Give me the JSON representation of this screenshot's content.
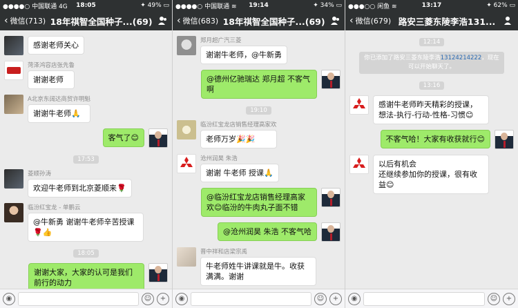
{
  "screens": [
    {
      "status": {
        "carrier": "●●●●○ 中国联通 4G",
        "time": "18:05",
        "right": "✦ 49% ▭"
      },
      "nav": {
        "back": "微信(713)",
        "title": "18年祺智全国种子...(69)"
      },
      "items": [
        {
          "kind": "msg",
          "side": "left",
          "avatar": "av-dark",
          "sender": "",
          "text": "感谢老师关心"
        },
        {
          "kind": "msg",
          "side": "left",
          "avatar": "av-logo",
          "sender": "菏泽鸿容店张先鲁",
          "text": "谢谢老师"
        },
        {
          "kind": "msg",
          "side": "left",
          "avatar": "av-photo",
          "sender": "A北京东阔达商贸许明魁",
          "text": "谢谢牛老师🙏"
        },
        {
          "kind": "msg",
          "side": "right",
          "avatar": "av-user",
          "sender": "",
          "text": "客气了😊"
        },
        {
          "kind": "ts",
          "text": "17:53"
        },
        {
          "kind": "msg",
          "side": "left",
          "avatar": "av-dark",
          "sender": "菱顺孙涛",
          "text": "欢迎牛老师到北京菱顺来🌹"
        },
        {
          "kind": "msg",
          "side": "left",
          "avatar": "av-person",
          "sender": "临汾红宝龙 - 单鹏云",
          "text": "@牛新勇 谢谢牛老师辛苦授课🌹👍"
        },
        {
          "kind": "ts",
          "text": "18:05"
        },
        {
          "kind": "msg",
          "side": "right",
          "avatar": "av-user",
          "sender": "",
          "text": "谢谢大家，大家的认可是我们前行的动力"
        }
      ]
    },
    {
      "status": {
        "carrier": "●●●●○ 中国联通 ≋",
        "time": "19:14",
        "right": "✦ 34% ▭"
      },
      "nav": {
        "back": "微信(683)",
        "title": "18年祺智全国种子...(69)"
      },
      "items": [
        {
          "kind": "msg",
          "side": "left",
          "avatar": "av-cat",
          "sender": "郑月超广汽三菱",
          "text": "谢谢牛老师，@牛新勇"
        },
        {
          "kind": "msg",
          "side": "right",
          "avatar": "av-user",
          "sender": "",
          "text": "@德州亿驰瑞达 郑月超 不客气啊"
        },
        {
          "kind": "ts",
          "text": "19:10"
        },
        {
          "kind": "msg",
          "side": "left",
          "avatar": "av-flower",
          "sender": "临汾红宝龙店销售经理高家欢",
          "text": "老师万岁🎉🎉"
        },
        {
          "kind": "msg",
          "side": "left",
          "avatar": "av-red",
          "sender": "沧州润昊 朱浩",
          "text": "谢谢 牛老师 授课🙏"
        },
        {
          "kind": "msg",
          "side": "right",
          "avatar": "av-user",
          "sender": "",
          "text": "@临汾红宝龙店销售经理高家欢😊临汾的牛肉丸子面不错"
        },
        {
          "kind": "msg",
          "side": "right",
          "avatar": "av-user",
          "sender": "",
          "text": "@沧州润昊 朱浩 不客气哈"
        },
        {
          "kind": "msg",
          "side": "left",
          "avatar": "av-light",
          "sender": "晋中祥和店梁宗禹",
          "text": "牛老师姓牛讲课就是牛。收获满满。谢谢"
        }
      ]
    },
    {
      "status": {
        "carrier": "●●●○○ 闲鱼 ≋",
        "time": "13:17",
        "right": "✦ 62% ▭"
      },
      "nav": {
        "back": "微信(679)",
        "title": "路安三菱东陵李浩131..."
      },
      "items": [
        {
          "kind": "ts",
          "text": "12:14"
        },
        {
          "kind": "sys",
          "pre": "你已添加了路安三菱东陵李浩",
          "hl": "13124214222",
          "post": "，现在可以开始聊天了。"
        },
        {
          "kind": "ts",
          "text": "13:16"
        },
        {
          "kind": "msg",
          "side": "left",
          "avatar": "av-red",
          "sender": "",
          "text": "感谢牛老师昨天精彩的授课，想法-执行-行动-性格-习惯😊"
        },
        {
          "kind": "msg",
          "side": "right",
          "avatar": "av-user",
          "sender": "",
          "text": "不客气哈！大家有收获就行😊"
        },
        {
          "kind": "msg",
          "side": "left",
          "avatar": "av-red",
          "sender": "",
          "text": "以后有机会\n还继续参加你的授课，很有收益😊"
        }
      ]
    }
  ],
  "input": {
    "voice_icon": "voice-icon",
    "emoji_icon": "emoji-icon",
    "add_icon": "add-icon"
  },
  "logo": {
    "red_text": "MITSUBISHI",
    "logo_text": "广汽三菱"
  }
}
